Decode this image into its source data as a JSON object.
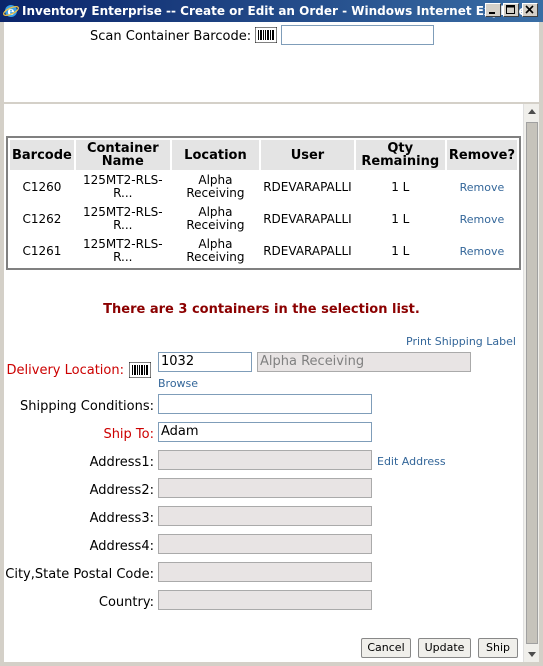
{
  "window": {
    "title": "Inventory Enterprise -- Create or Edit an Order - Windows Internet Explorer"
  },
  "scan": {
    "label": "Scan Container Barcode:",
    "value": ""
  },
  "table": {
    "headers": [
      "Barcode",
      "Container Name",
      "Location",
      "User",
      "Qty Remaining",
      "Remove?"
    ],
    "rows": [
      {
        "barcode": "C1260",
        "name_line1": "125MT2-RLS-",
        "name_line2": "R...",
        "loc_line1": "Alpha",
        "loc_line2": "Receiving",
        "user": "RDEVARAPALLI",
        "qty": "1 L",
        "remove": "Remove"
      },
      {
        "barcode": "C1262",
        "name_line1": "125MT2-RLS-",
        "name_line2": "R...",
        "loc_line1": "Alpha",
        "loc_line2": "Receiving",
        "user": "RDEVARAPALLI",
        "qty": "1 L",
        "remove": "Remove"
      },
      {
        "barcode": "C1261",
        "name_line1": "125MT2-RLS-",
        "name_line2": "R...",
        "loc_line1": "Alpha",
        "loc_line2": "Receiving",
        "user": "RDEVARAPALLI",
        "qty": "1 L",
        "remove": "Remove"
      }
    ]
  },
  "message": "There are 3 containers in the selection list.",
  "print_label": "Print Shipping Label",
  "form": {
    "delivery_location_label": "Delivery Location:",
    "delivery_location_code": "1032",
    "delivery_location_name": "Alpha Receiving",
    "browse": "Browse",
    "shipping_conditions_label": "Shipping Conditions:",
    "shipping_conditions": "",
    "ship_to_label": "Ship To:",
    "ship_to": "Adam",
    "address1_label": "Address1:",
    "address2_label": "Address2:",
    "address3_label": "Address3:",
    "address4_label": "Address4:",
    "city_label": "City,State Postal Code:",
    "country_label": "Country:",
    "edit_address": "Edit Address"
  },
  "buttons": {
    "cancel": "Cancel",
    "update": "Update",
    "ship": "Ship"
  },
  "colors": {
    "required_label": "#cc0000",
    "link": "#336699",
    "message": "#8b0000"
  }
}
